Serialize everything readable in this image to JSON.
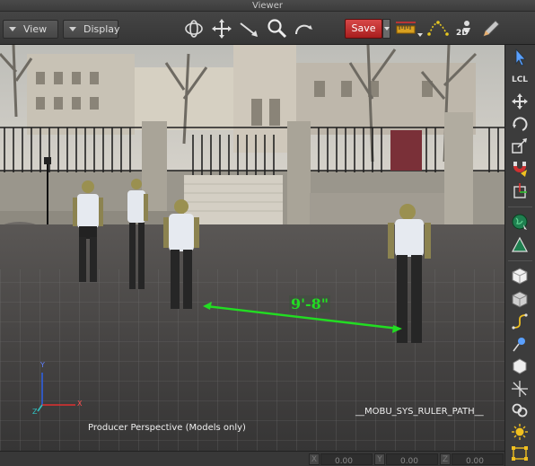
{
  "window": {
    "title": "Viewer"
  },
  "toolbar": {
    "view_label": "View",
    "display_label": "Display",
    "save_label": "Save",
    "tools": [
      "orbit-icon",
      "move-icon",
      "select-arrow-icon",
      "zoom-icon",
      "rotate-camera-icon"
    ],
    "right_tools": [
      "ruler-icon",
      "path-icon",
      "2d-icon",
      "edit-icon"
    ],
    "right_tool_2d_text": "2D"
  },
  "viewport": {
    "camera_label": "Producer Perspective (Models only)",
    "ruler_measure": "9'-8\"",
    "ruler_path_label": "__MOBU_SYS_RULER_PATH__",
    "axes": {
      "x": "X",
      "y": "Y",
      "z": "Z"
    }
  },
  "sidebar": {
    "tools": [
      "select-icon",
      "local-icon",
      "translate-icon",
      "rotate-icon",
      "scale-icon",
      "magnet-icon",
      "pivot-icon",
      "globe-icon",
      "ruler-triangle-icon",
      "cube-white-icon",
      "cube-grey-icon",
      "curve-icon",
      "light-icon",
      "hexagon-icon",
      "null-icon",
      "link-icon",
      "sun-icon",
      "frame-icon"
    ],
    "local_text": "LCL"
  },
  "status": {
    "x_label": "X",
    "x_value": "0.00",
    "y_label": "Y",
    "y_value": "0.00",
    "z_label": "Z",
    "z_value": "0.00"
  },
  "colors": {
    "save_button": "#c83030",
    "ruler_line": "#22dd22",
    "axis_x": "#e03030",
    "axis_y": "#3060e0",
    "axis_z": "#30c0c0"
  }
}
